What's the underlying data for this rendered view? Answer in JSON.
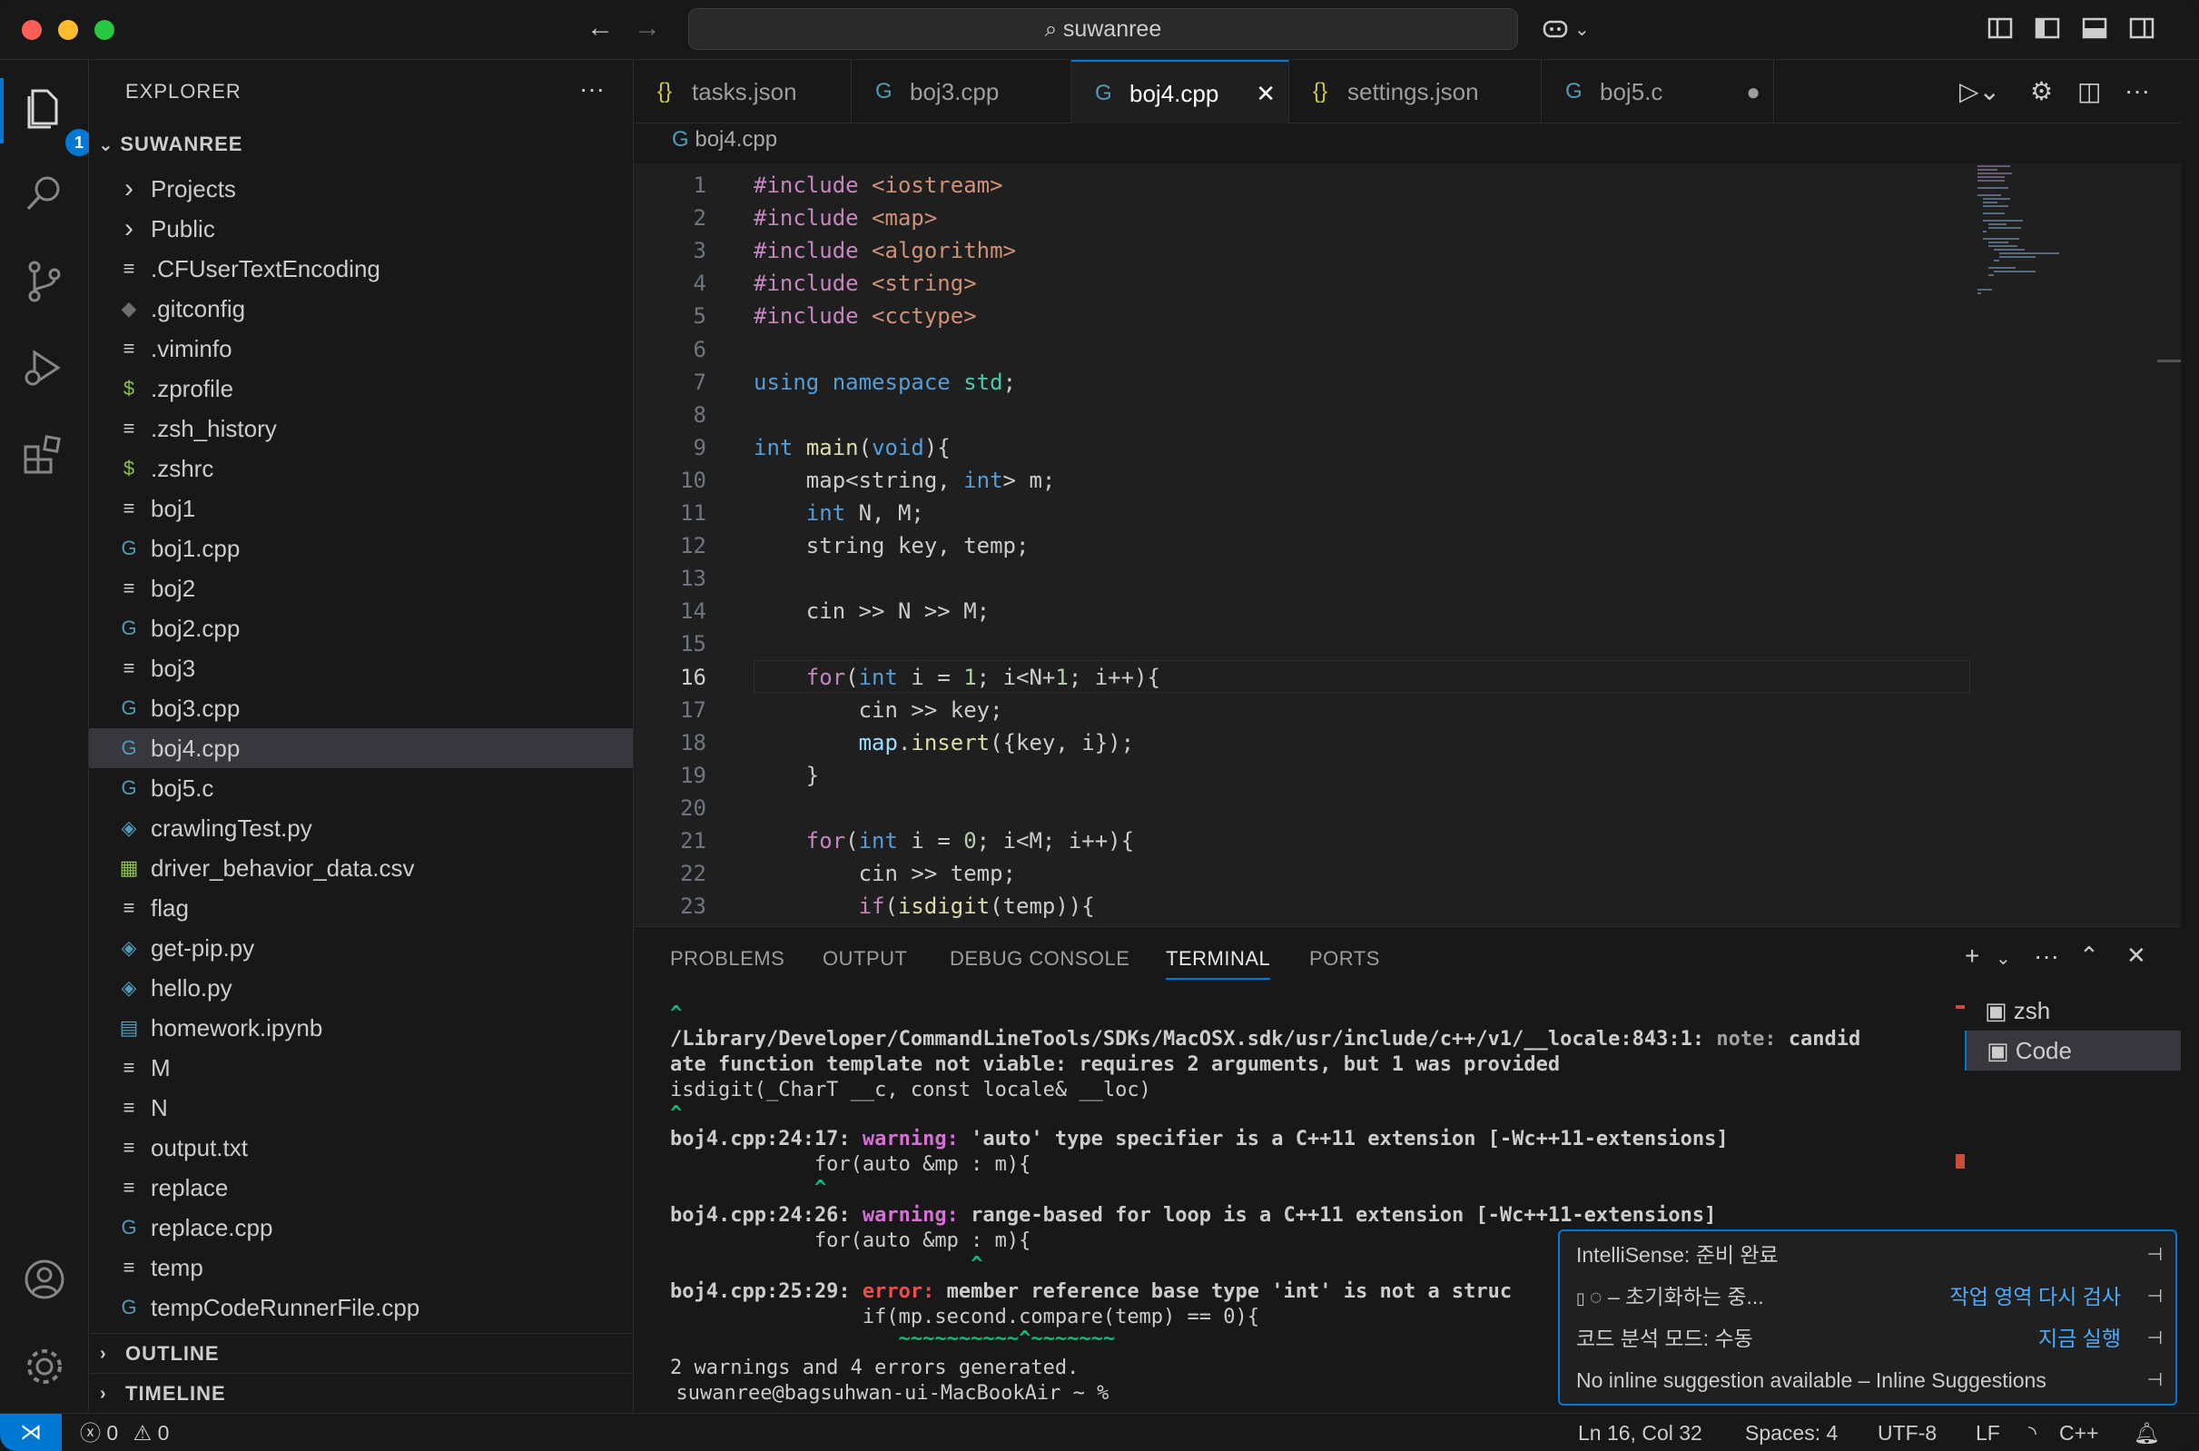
{
  "window": {
    "search_text": "suwanree"
  },
  "activity": {
    "explorer_badge": "1"
  },
  "sidebar": {
    "title": "EXPLORER",
    "root": "SUWANREE",
    "items": [
      {
        "name": "Projects",
        "icon": "chevron-right",
        "type": "folder"
      },
      {
        "name": "Public",
        "icon": "chevron-right",
        "type": "folder"
      },
      {
        "name": ".CFUserTextEncoding",
        "icon": "lines",
        "type": "file"
      },
      {
        "name": ".gitconfig",
        "icon": "git",
        "type": "file"
      },
      {
        "name": ".viminfo",
        "icon": "lines",
        "type": "file"
      },
      {
        "name": ".zprofile",
        "icon": "dollar",
        "type": "file"
      },
      {
        "name": ".zsh_history",
        "icon": "lines",
        "type": "file"
      },
      {
        "name": ".zshrc",
        "icon": "dollar",
        "type": "file"
      },
      {
        "name": "boj1",
        "icon": "lines",
        "type": "file"
      },
      {
        "name": "boj1.cpp",
        "icon": "cpp",
        "type": "file"
      },
      {
        "name": "boj2",
        "icon": "lines",
        "type": "file"
      },
      {
        "name": "boj2.cpp",
        "icon": "cpp",
        "type": "file"
      },
      {
        "name": "boj3",
        "icon": "lines",
        "type": "file"
      },
      {
        "name": "boj3.cpp",
        "icon": "cpp",
        "type": "file"
      },
      {
        "name": "boj4.cpp",
        "icon": "cpp",
        "type": "file",
        "selected": true
      },
      {
        "name": "boj5.c",
        "icon": "cpp",
        "type": "file"
      },
      {
        "name": "crawlingTest.py",
        "icon": "python",
        "type": "file"
      },
      {
        "name": "driver_behavior_data.csv",
        "icon": "table",
        "type": "file"
      },
      {
        "name": "flag",
        "icon": "lines",
        "type": "file"
      },
      {
        "name": "get-pip.py",
        "icon": "python",
        "type": "file"
      },
      {
        "name": "hello.py",
        "icon": "python",
        "type": "file"
      },
      {
        "name": "homework.ipynb",
        "icon": "notebook",
        "type": "file"
      },
      {
        "name": "M",
        "icon": "lines",
        "type": "file"
      },
      {
        "name": "N",
        "icon": "lines",
        "type": "file"
      },
      {
        "name": "output.txt",
        "icon": "lines",
        "type": "file"
      },
      {
        "name": "replace",
        "icon": "lines",
        "type": "file"
      },
      {
        "name": "replace.cpp",
        "icon": "cpp",
        "type": "file"
      },
      {
        "name": "temp",
        "icon": "lines",
        "type": "file"
      },
      {
        "name": "tempCodeRunnerFile.cpp",
        "icon": "cpp",
        "type": "file"
      }
    ],
    "outline": "OUTLINE",
    "timeline": "TIMELINE"
  },
  "tabs": [
    {
      "label": "tasks.json",
      "icon": "{}"
    },
    {
      "label": "boj3.cpp",
      "icon": "G"
    },
    {
      "label": "boj4.cpp",
      "icon": "G",
      "active": true,
      "close": "✕"
    },
    {
      "label": "settings.json",
      "icon": "{}"
    },
    {
      "label": "boj5.c",
      "icon": "G",
      "dirty": "●"
    }
  ],
  "breadcrumb": "boj4.cpp",
  "code": [
    {
      "n": "1",
      "t": "#include <iostream>"
    },
    {
      "n": "2",
      "t": "#include <map>"
    },
    {
      "n": "3",
      "t": "#include <algorithm>"
    },
    {
      "n": "4",
      "t": "#include <string>"
    },
    {
      "n": "5",
      "t": "#include <cctype>"
    },
    {
      "n": "6",
      "t": ""
    },
    {
      "n": "7",
      "t": "using namespace std;"
    },
    {
      "n": "8",
      "t": ""
    },
    {
      "n": "9",
      "t": "int main(void){"
    },
    {
      "n": "10",
      "t": "    map<string, int> m;"
    },
    {
      "n": "11",
      "t": "    int N, M;"
    },
    {
      "n": "12",
      "t": "    string key, temp;"
    },
    {
      "n": "13",
      "t": ""
    },
    {
      "n": "14",
      "t": "    cin >> N >> M;"
    },
    {
      "n": "15",
      "t": ""
    },
    {
      "n": "16",
      "t": "    for(int i = 1; i<N+1; i++){"
    },
    {
      "n": "17",
      "t": "        cin >> key;"
    },
    {
      "n": "18",
      "t": "        map.insert({key, i});"
    },
    {
      "n": "19",
      "t": "    }"
    },
    {
      "n": "20",
      "t": ""
    },
    {
      "n": "21",
      "t": "    for(int i = 0; i<M; i++){"
    },
    {
      "n": "22",
      "t": "        cin >> temp;"
    },
    {
      "n": "23",
      "t": "        if(isdigit(temp)){"
    }
  ],
  "panel": {
    "tabs": [
      "PROBLEMS",
      "OUTPUT",
      "DEBUG CONSOLE",
      "TERMINAL",
      "PORTS"
    ],
    "active_tab": "TERMINAL",
    "terminals": [
      "zsh",
      "Code"
    ],
    "lines": {
      "l0": "^",
      "l1a": "/Library/Developer/CommandLineTools/SDKs/MacOSX.sdk/usr/include/c++/v1/__locale:843:1: ",
      "l1b": "note: ",
      "l1c": "candid",
      "l2": "ate function template not viable: requires 2 arguments, but 1 was provided",
      "l3": "isdigit(_CharT __c, const locale& __loc)",
      "l4": "^",
      "l5a": "boj4.cpp:24:17: ",
      "l5b": "warning: ",
      "l5c": "'auto' type specifier is a C++11 extension [-Wc++11-extensions]",
      "l6": "            for(auto &mp : m){",
      "l7": "            ^",
      "l8a": "boj4.cpp:24:26: ",
      "l8b": "warning: ",
      "l8c": "range-based for loop is a C++11 extension [-Wc++11-extensions]",
      "l9": "            for(auto &mp : m){",
      "l10": "                         ^",
      "l11a": "boj4.cpp:25:29: ",
      "l11b": "error: ",
      "l11c": "member reference base type 'int' is not a struc",
      "l12": "                if(mp.second.compare(temp) == 0){",
      "l13": "                   ~~~~~~~~~~^~~~~~~~",
      "l14": "2 warnings and 4 errors generated.",
      "l15": "suwanree@bagsuhwan-ui-MacBookAir ~ %"
    }
  },
  "popup": {
    "r1": "IntelliSense: 준비 완료",
    "r2": "◌ – 초기화하는 중...",
    "r2_action": "작업 영역 다시 검사",
    "r3": "코드 분석 모드: 수동",
    "r3_action": "지금 실행",
    "r4": "No inline suggestion available – Inline Suggestions"
  },
  "status": {
    "errors": "0",
    "warnings": "0",
    "position": "Ln 16, Col 32",
    "spaces": "Spaces: 4",
    "encoding": "UTF-8",
    "eol": "LF",
    "language": "C++"
  }
}
